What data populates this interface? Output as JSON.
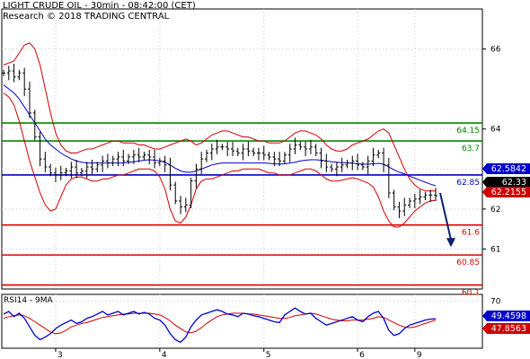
{
  "header": {
    "title": "LIGHT CRUDE OIL - 30min - 08:42:00 (CET)",
    "source": "Research © 2018 TRADING CENTRAL"
  },
  "colors": {
    "price": "#000000",
    "bollinger": "#cc0000",
    "moving_average": "#0000cc",
    "resistance": "#008800",
    "pivot": "#0000cc",
    "support": "#dd0000",
    "forecast_arrow": "#0a1f6e",
    "rsi": "#0000cc",
    "rsi_ma": "#cc0000",
    "grid": "#c8c8c8"
  },
  "chart_data": [
    {
      "type": "line",
      "name_shown": "price panel",
      "x_ticks": [
        "3",
        "4",
        "5",
        "6",
        "9"
      ],
      "y_ticks": [
        "66",
        "64",
        "63",
        "62",
        "61"
      ],
      "ylim": [
        60.0,
        67.0
      ],
      "levels": [
        {
          "label": "64.15",
          "value": 64.15,
          "kind": "resistance"
        },
        {
          "label": "63.7",
          "value": 63.7,
          "kind": "resistance"
        },
        {
          "label": "62.85",
          "value": 62.85,
          "kind": "pivot"
        },
        {
          "label": "61.6",
          "value": 61.6,
          "kind": "support"
        },
        {
          "label": "60.85",
          "value": 60.85,
          "kind": "support"
        },
        {
          "label": "60.1",
          "value": 60.1,
          "kind": "support"
        }
      ],
      "value_tags": [
        {
          "label": "62.5842",
          "kind": "moving_average"
        },
        {
          "label": "62.33",
          "kind": "price"
        },
        {
          "label": "62.2155",
          "kind": "bollinger"
        }
      ],
      "forecast": {
        "from": 62.4,
        "to": 61.05
      },
      "close": [
        65.4,
        65.45,
        65.3,
        65.4,
        65.0,
        64.4,
        63.8,
        63.25,
        63.05,
        62.9,
        62.85,
        62.9,
        62.95,
        63.05,
        62.9,
        62.95,
        63.05,
        63.0,
        63.1,
        63.2,
        63.15,
        63.25,
        63.3,
        63.2,
        63.3,
        63.35,
        63.3,
        63.35,
        63.3,
        63.15,
        63.2,
        63.1,
        62.6,
        62.2,
        62.05,
        62.1,
        62.7,
        63.0,
        63.25,
        63.4,
        63.5,
        63.55,
        63.55,
        63.5,
        63.45,
        63.4,
        63.5,
        63.45,
        63.4,
        63.4,
        63.35,
        63.3,
        63.25,
        63.2,
        63.35,
        63.5,
        63.6,
        63.55,
        63.5,
        63.55,
        63.4,
        63.2,
        63.05,
        63.0,
        63.05,
        63.1,
        63.15,
        63.2,
        63.1,
        63.05,
        63.2,
        63.35,
        63.4,
        63.1,
        62.4,
        62.05,
        61.95,
        62.1,
        62.2,
        62.25,
        62.3,
        62.35,
        62.35,
        62.33
      ],
      "ma": [
        65.1,
        65.0,
        64.9,
        64.75,
        64.55,
        64.35,
        64.15,
        63.95,
        63.75,
        63.6,
        63.5,
        63.4,
        63.32,
        63.25,
        63.2,
        63.17,
        63.15,
        63.15,
        63.15,
        63.15,
        63.15,
        63.15,
        63.15,
        63.15,
        63.17,
        63.18,
        63.2,
        63.22,
        63.23,
        63.22,
        63.2,
        63.17,
        63.1,
        63.02,
        62.95,
        62.92,
        62.92,
        62.95,
        63.0,
        63.05,
        63.1,
        63.13,
        63.15,
        63.15,
        63.15,
        63.15,
        63.15,
        63.15,
        63.15,
        63.15,
        63.15,
        63.14,
        63.13,
        63.12,
        63.13,
        63.15,
        63.17,
        63.2,
        63.22,
        63.23,
        63.23,
        63.22,
        63.2,
        63.18,
        63.17,
        63.16,
        63.15,
        63.15,
        63.13,
        63.12,
        63.12,
        63.13,
        63.14,
        63.12,
        63.05,
        62.98,
        62.92,
        62.88,
        62.82,
        62.77,
        62.72,
        62.67,
        62.62,
        62.58
      ],
      "bb_upper": [
        65.6,
        65.65,
        65.7,
        65.9,
        66.1,
        66.15,
        66.0,
        65.6,
        65.0,
        64.4,
        63.9,
        63.6,
        63.45,
        63.4,
        63.4,
        63.45,
        63.5,
        63.5,
        63.55,
        63.6,
        63.65,
        63.7,
        63.7,
        63.65,
        63.65,
        63.65,
        63.6,
        63.6,
        63.55,
        63.5,
        63.5,
        63.55,
        63.6,
        63.65,
        63.7,
        63.75,
        63.7,
        63.6,
        63.65,
        63.75,
        63.85,
        63.9,
        63.95,
        63.95,
        63.9,
        63.85,
        63.8,
        63.8,
        63.75,
        63.7,
        63.7,
        63.65,
        63.65,
        63.65,
        63.7,
        63.8,
        63.9,
        63.95,
        63.95,
        63.9,
        63.85,
        63.75,
        63.6,
        63.5,
        63.45,
        63.45,
        63.5,
        63.6,
        63.65,
        63.7,
        63.75,
        63.85,
        63.95,
        64.0,
        63.9,
        63.6,
        63.3,
        63.0,
        62.75,
        62.6,
        62.5,
        62.45,
        62.45,
        62.45
      ],
      "bb_lower": [
        64.9,
        64.8,
        64.6,
        64.2,
        63.7,
        63.2,
        62.8,
        62.4,
        62.1,
        61.95,
        62.0,
        62.3,
        62.6,
        62.75,
        62.8,
        62.8,
        62.75,
        62.7,
        62.7,
        62.75,
        62.75,
        62.8,
        62.85,
        62.85,
        62.9,
        62.95,
        63.0,
        63.0,
        63.0,
        62.95,
        62.8,
        62.5,
        62.0,
        61.7,
        61.65,
        61.8,
        62.1,
        62.5,
        62.7,
        62.75,
        62.75,
        62.8,
        62.85,
        62.9,
        62.95,
        62.95,
        63.0,
        63.0,
        63.0,
        63.0,
        62.95,
        62.9,
        62.9,
        62.85,
        62.85,
        62.85,
        62.9,
        62.95,
        63.0,
        63.0,
        62.95,
        62.85,
        62.75,
        62.7,
        62.7,
        62.72,
        62.75,
        62.78,
        62.75,
        62.7,
        62.65,
        62.55,
        62.3,
        61.95,
        61.7,
        61.55,
        61.55,
        61.65,
        61.8,
        61.95,
        62.05,
        62.15,
        62.2,
        62.22
      ]
    },
    {
      "type": "line",
      "title": "RSI14 - 9MA",
      "y_ticks": [
        "70"
      ],
      "ylim": [
        15,
        78
      ],
      "value_tags": [
        {
          "label": "49.4598",
          "kind": "rsi"
        },
        {
          "label": "47.8563",
          "kind": "rsi_ma"
        }
      ],
      "rsi": [
        55,
        58,
        52,
        56,
        50,
        40,
        30,
        25,
        28,
        32,
        38,
        42,
        45,
        48,
        44,
        46,
        50,
        52,
        55,
        58,
        54,
        56,
        58,
        54,
        56,
        58,
        55,
        57,
        55,
        50,
        48,
        42,
        32,
        25,
        22,
        28,
        40,
        48,
        54,
        56,
        58,
        60,
        58,
        55,
        54,
        52,
        56,
        55,
        53,
        52,
        50,
        48,
        46,
        45,
        54,
        58,
        62,
        58,
        55,
        56,
        50,
        46,
        42,
        44,
        46,
        48,
        50,
        52,
        48,
        46,
        52,
        56,
        58,
        50,
        36,
        30,
        32,
        38,
        42,
        44,
        46,
        48,
        49,
        49.46
      ],
      "rsi_ma": [
        50,
        52,
        53,
        54,
        53,
        50,
        46,
        42,
        38,
        34,
        32,
        33,
        36,
        40,
        42,
        44,
        45,
        47,
        49,
        51,
        52,
        53,
        54,
        55,
        55,
        56,
        56,
        56,
        56,
        55,
        54,
        51,
        47,
        42,
        38,
        34,
        33,
        35,
        39,
        44,
        48,
        52,
        54,
        55,
        56,
        56,
        56,
        55,
        55,
        54,
        53,
        52,
        51,
        50,
        50,
        51,
        53,
        54,
        55,
        56,
        55,
        53,
        51,
        49,
        48,
        47,
        47,
        48,
        48,
        48,
        49,
        50,
        52,
        51,
        48,
        45,
        42,
        40,
        39,
        40,
        42,
        44,
        46,
        47.86
      ]
    }
  ]
}
